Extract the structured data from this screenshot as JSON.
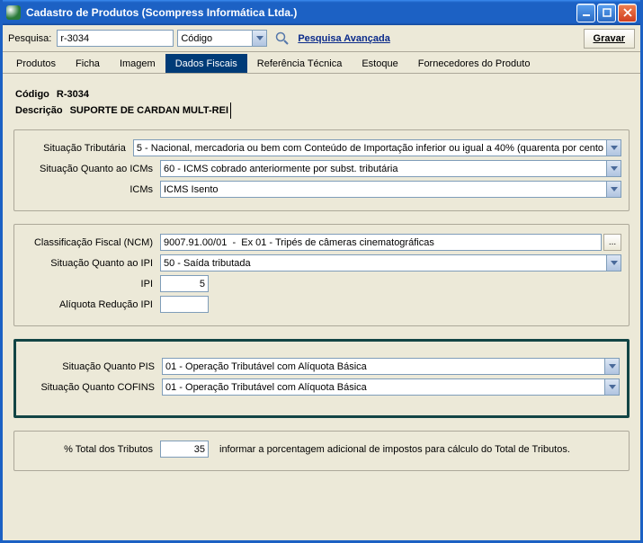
{
  "window": {
    "title": "Cadastro de Produtos (Scompress Informática Ltda.)"
  },
  "searchbar": {
    "label": "Pesquisa:",
    "value": "r-3034",
    "type": "Código",
    "advanced_link": "Pesquisa Avançada",
    "save_button": "Gravar"
  },
  "tabs": {
    "produtos": "Produtos",
    "ficha": "Ficha",
    "imagem": "Imagem",
    "dados_fiscais": "Dados Fiscais",
    "ref_tecnica": "Referência Técnica",
    "estoque": "Estoque",
    "fornecedores": "Fornecedores do Produto"
  },
  "header": {
    "codigo_label": "Código",
    "codigo_value": "R-3034",
    "descricao_label": "Descrição",
    "descricao_value": "SUPORTE DE CARDAN MULT-REI"
  },
  "panel1": {
    "sit_trib_label": "Situação Tributária",
    "sit_trib_value": "5 - Nacional, mercadoria ou bem com Conteúdo de Importação inferior ou igual a 40% (quarenta por cento",
    "sit_icms_label": "Situação Quanto ao ICMs",
    "sit_icms_value": "60 - ICMS cobrado anteriormente por subst. tributária",
    "icms_label": "ICMs",
    "icms_value": "ICMS Isento"
  },
  "panel2": {
    "ncm_label": "Classificação Fiscal (NCM)",
    "ncm_value": "9007.91.00/01  -  Ex 01 - Tripés de câmeras cinematográficas",
    "sit_ipi_label": "Situação Quanto ao IPI",
    "sit_ipi_value": "50 - Saída tributada",
    "ipi_label": "IPI",
    "ipi_value": "5",
    "aliq_red_label": "Alíquota Redução IPI",
    "aliq_red_value": ""
  },
  "panel3": {
    "pis_label": "Situação Quanto PIS",
    "pis_value": "01 - Operação Tributável com Alíquota Básica",
    "cofins_label": "Situação Quanto COFINS",
    "cofins_value": "01 - Operação Tributável com Alíquota Básica"
  },
  "panel4": {
    "pct_label": "% Total dos Tributos",
    "pct_value": "35",
    "info": "informar a porcentagem adicional de impostos para cálculo do Total de Tributos."
  }
}
